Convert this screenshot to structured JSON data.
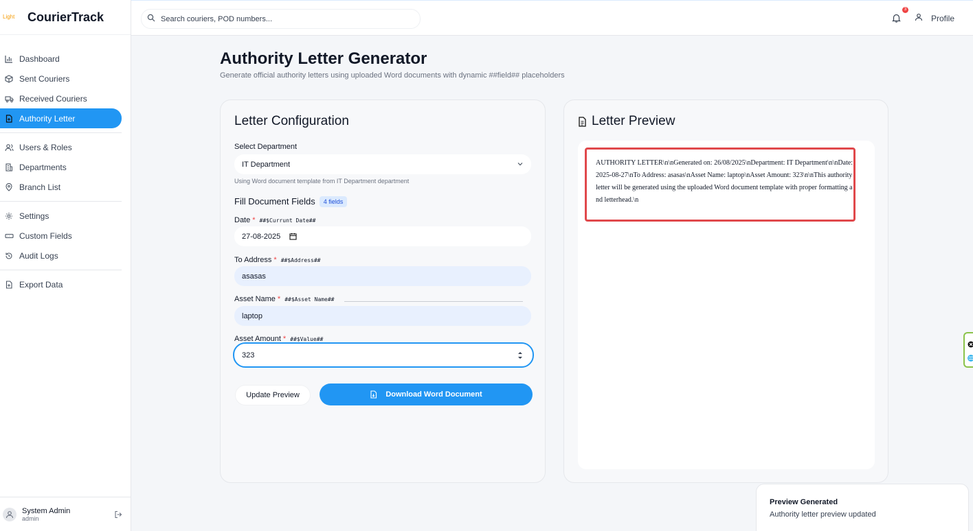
{
  "brand": {
    "logo_text": "Light",
    "name": "CourierTrack"
  },
  "sidebar": {
    "group1": [
      {
        "label": "Dashboard",
        "icon": "bar-chart-icon"
      },
      {
        "label": "Sent Couriers",
        "icon": "package-icon"
      },
      {
        "label": "Received Couriers",
        "icon": "truck-icon"
      },
      {
        "label": "Authority Letter",
        "icon": "document-icon",
        "active": true
      }
    ],
    "group2": [
      {
        "label": "Users & Roles",
        "icon": "users-icon"
      },
      {
        "label": "Departments",
        "icon": "building-icon"
      },
      {
        "label": "Branch List",
        "icon": "map-pin-icon"
      }
    ],
    "group3": [
      {
        "label": "Settings",
        "icon": "gear-icon"
      },
      {
        "label": "Custom Fields",
        "icon": "input-icon"
      },
      {
        "label": "Audit Logs",
        "icon": "history-icon"
      }
    ],
    "group4": [
      {
        "label": "Export Data",
        "icon": "file-export-icon"
      }
    ],
    "user": {
      "name": "System Admin",
      "role": "admin"
    }
  },
  "topbar": {
    "search_placeholder": "Search couriers, POD numbers...",
    "notification_count": "3",
    "profile_label": "Profile"
  },
  "page": {
    "title": "Authority Letter Generator",
    "subtitle": "Generate official authority letters using uploaded Word documents with dynamic ##field## placeholders"
  },
  "config": {
    "title": "Letter Configuration",
    "department_label": "Select Department",
    "department_value": "IT Department",
    "template_hint": "Using Word document template from IT Department department",
    "fields_heading": "Fill Document Fields",
    "fields_count": "4 fields",
    "fields": [
      {
        "label": "Date",
        "required": "*",
        "placeholder": "##$Currunt Date##",
        "value": "27-08-2025"
      },
      {
        "label": "To Address",
        "required": "*",
        "placeholder": "##$Address##",
        "value": "asasas"
      },
      {
        "label": "Asset Name",
        "required": "*",
        "placeholder": "##$Asset Name##",
        "value": "laptop"
      },
      {
        "label": "Asset Amount",
        "required": "*",
        "placeholder": "##$Value##",
        "value": "323"
      }
    ],
    "update_button": "Update Preview",
    "download_button": "Download Word Document"
  },
  "preview": {
    "title": "Letter Preview",
    "text": "AUTHORITY LETTER\\n\\nGenerated on: 26/08/2025\\nDepartment: IT Department\\n\\nDate: 2025-08-27\\nTo Address: asasas\\nAsset Name: laptop\\nAsset Amount: 323\\n\\nThis authority letter will be generated using the uploaded Word document template with proper formatting and letterhead.\\n"
  },
  "toast": {
    "title": "Preview Generated",
    "body": "Authority letter preview updated"
  },
  "colors": {
    "accent": "#2196f3",
    "highlight_border": "#e0484b",
    "badge": "#ef4444"
  }
}
